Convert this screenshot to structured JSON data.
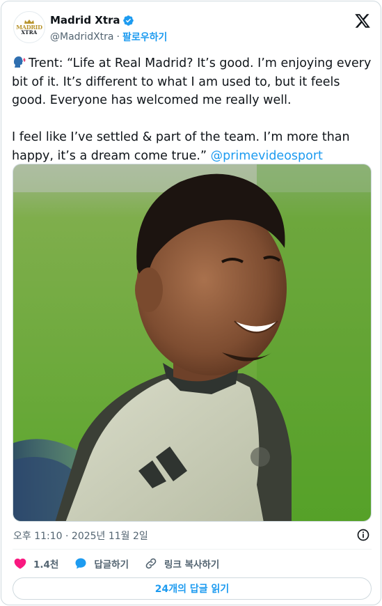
{
  "author": {
    "display_name": "Madrid Xtra",
    "handle": "@MadridXtra",
    "separator": "·",
    "follow_label": "팔로우하기",
    "avatar_line1": "MADRID",
    "avatar_line2": "XTRA",
    "verified_color": "#1d9bf0"
  },
  "tweet": {
    "emoji": "speaking-head-icon",
    "lines": [
      "Trent: “Life at Real Madrid? It’s good. I’m enjoying every bit of it. It’s different to what I am used to, but it feels good. Everyone has welcomed me really well."
    ],
    "line2_text": "I feel like I’ve settled & part of the team. I’m more than happy, it’s a dream come true.”",
    "mention": "@primevideosport"
  },
  "timestamp": "오후 11:10 · 2025년 11월 2일",
  "actions": {
    "like_count": "1.4천",
    "reply_label": "답글하기",
    "copy_link_label": "링크 복사하기"
  },
  "read_replies_label": "24개의 답글 읽기",
  "colors": {
    "accent": "#1d9bf0",
    "like": "#f91880",
    "text": "#0f1419",
    "muted": "#536471"
  }
}
